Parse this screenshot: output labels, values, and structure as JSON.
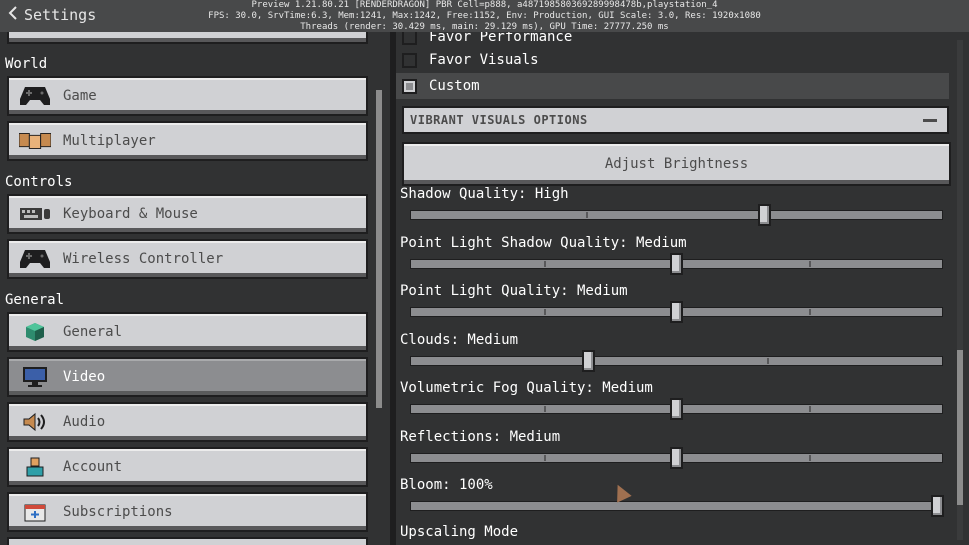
{
  "header": {
    "back_label": "Settings"
  },
  "debug": {
    "line1": "Preview 1.21.80.21 [RENDERDRAGON] PBR Cell=p888, a487198580369289998478b,playstation_4",
    "line2": "FPS: 30.0, SrvTime:6.3, Mem:1241, Max:1242, Free:1152, Env: Production, GUI Scale: 3.0, Res: 1920x1080",
    "line3": "Threads (render: 30.429 ms, main: 29.129 ms), GPU Time: 27777.250 ms"
  },
  "sidebar": {
    "sections": [
      {
        "title": "World",
        "items": [
          {
            "label": "Game",
            "icon": "controller-icon"
          },
          {
            "label": "Multiplayer",
            "icon": "multiplayer-icon"
          }
        ]
      },
      {
        "title": "Controls",
        "items": [
          {
            "label": "Keyboard & Mouse",
            "icon": "keyboard-icon"
          },
          {
            "label": "Wireless Controller",
            "icon": "controller-icon"
          }
        ]
      },
      {
        "title": "General",
        "items": [
          {
            "label": "General",
            "icon": "cube-icon"
          },
          {
            "label": "Video",
            "icon": "monitor-icon",
            "selected": true
          },
          {
            "label": "Audio",
            "icon": "speaker-icon"
          },
          {
            "label": "Account",
            "icon": "account-icon"
          },
          {
            "label": "Subscriptions",
            "icon": "calendar-icon"
          }
        ]
      }
    ]
  },
  "main": {
    "partial_option": "Favor Performance",
    "options": [
      {
        "label": "Favor Visuals",
        "selected": false
      },
      {
        "label": "Custom",
        "selected": true
      }
    ],
    "section_title": "VIBRANT VISUALS OPTIONS",
    "adjust_brightness": "Adjust Brightness",
    "sliders": [
      {
        "label": "Shadow Quality: High",
        "value": 0.67,
        "ticks": [
          0.33,
          0.67
        ]
      },
      {
        "label": "Point Light Shadow Quality: Medium",
        "value": 0.5,
        "ticks": [
          0.25,
          0.5,
          0.75
        ]
      },
      {
        "label": "Point Light Quality: Medium",
        "value": 0.5,
        "ticks": [
          0.25,
          0.5,
          0.75
        ]
      },
      {
        "label": "Clouds: Medium",
        "value": 0.33,
        "ticks": [
          0.33,
          0.67
        ]
      },
      {
        "label": "Volumetric Fog Quality: Medium",
        "value": 0.5,
        "ticks": [
          0.25,
          0.5,
          0.75
        ]
      },
      {
        "label": "Reflections: Medium",
        "value": 0.5,
        "ticks": [
          0.25,
          0.5,
          0.75
        ]
      },
      {
        "label": "Bloom: 100%",
        "value": 1.0,
        "ticks": []
      }
    ],
    "last_label": "Upscaling Mode"
  }
}
